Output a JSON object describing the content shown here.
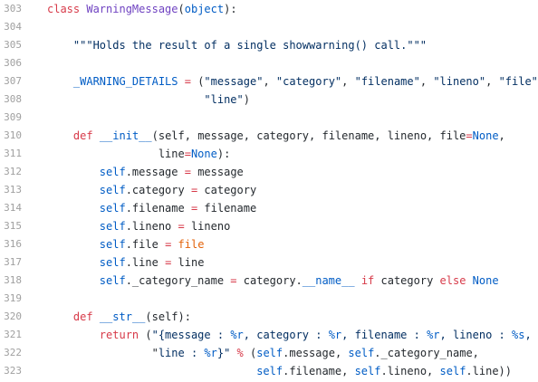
{
  "lines": [
    {
      "num": "303",
      "tokens": [
        {
          "t": "class",
          "c": "kw"
        },
        {
          "t": " "
        },
        {
          "t": "WarningMessage",
          "c": "cls"
        },
        {
          "t": "("
        },
        {
          "t": "object",
          "c": "bi"
        },
        {
          "t": "):"
        }
      ]
    },
    {
      "num": "304",
      "tokens": []
    },
    {
      "num": "305",
      "tokens": [
        {
          "t": "    "
        },
        {
          "t": "\"\"\"Holds the result of a single showwarning() call.\"\"\"",
          "c": "str"
        }
      ]
    },
    {
      "num": "306",
      "tokens": []
    },
    {
      "num": "307",
      "tokens": [
        {
          "t": "    "
        },
        {
          "t": "_WARNING_DETAILS",
          "c": "fn"
        },
        {
          "t": " "
        },
        {
          "t": "=",
          "c": "op"
        },
        {
          "t": " ("
        },
        {
          "t": "\"message\"",
          "c": "str"
        },
        {
          "t": ", "
        },
        {
          "t": "\"category\"",
          "c": "str"
        },
        {
          "t": ", "
        },
        {
          "t": "\"filename\"",
          "c": "str"
        },
        {
          "t": ", "
        },
        {
          "t": "\"lineno\"",
          "c": "str"
        },
        {
          "t": ", "
        },
        {
          "t": "\"file\"",
          "c": "str"
        },
        {
          "t": ","
        }
      ]
    },
    {
      "num": "308",
      "tokens": [
        {
          "t": "                        "
        },
        {
          "t": "\"line\"",
          "c": "str"
        },
        {
          "t": ")"
        }
      ]
    },
    {
      "num": "309",
      "tokens": []
    },
    {
      "num": "310",
      "tokens": [
        {
          "t": "    "
        },
        {
          "t": "def",
          "c": "kw"
        },
        {
          "t": " "
        },
        {
          "t": "__init__",
          "c": "fn"
        },
        {
          "t": "(self, message, category, filename, lineno, file"
        },
        {
          "t": "=",
          "c": "op"
        },
        {
          "t": "None",
          "c": "bi"
        },
        {
          "t": ","
        }
      ]
    },
    {
      "num": "311",
      "tokens": [
        {
          "t": "                 line"
        },
        {
          "t": "=",
          "c": "op"
        },
        {
          "t": "None",
          "c": "bi"
        },
        {
          "t": "):"
        }
      ]
    },
    {
      "num": "312",
      "tokens": [
        {
          "t": "        "
        },
        {
          "t": "self",
          "c": "bi"
        },
        {
          "t": ".message "
        },
        {
          "t": "=",
          "c": "op"
        },
        {
          "t": " message"
        }
      ]
    },
    {
      "num": "313",
      "tokens": [
        {
          "t": "        "
        },
        {
          "t": "self",
          "c": "bi"
        },
        {
          "t": ".category "
        },
        {
          "t": "=",
          "c": "op"
        },
        {
          "t": " category"
        }
      ]
    },
    {
      "num": "314",
      "tokens": [
        {
          "t": "        "
        },
        {
          "t": "self",
          "c": "bi"
        },
        {
          "t": ".filename "
        },
        {
          "t": "=",
          "c": "op"
        },
        {
          "t": " filename"
        }
      ]
    },
    {
      "num": "315",
      "tokens": [
        {
          "t": "        "
        },
        {
          "t": "self",
          "c": "bi"
        },
        {
          "t": ".lineno "
        },
        {
          "t": "=",
          "c": "op"
        },
        {
          "t": " lineno"
        }
      ]
    },
    {
      "num": "316",
      "tokens": [
        {
          "t": "        "
        },
        {
          "t": "self",
          "c": "bi"
        },
        {
          "t": ".file "
        },
        {
          "t": "=",
          "c": "op"
        },
        {
          "t": " "
        },
        {
          "t": "file",
          "c": "hl"
        }
      ]
    },
    {
      "num": "317",
      "tokens": [
        {
          "t": "        "
        },
        {
          "t": "self",
          "c": "bi"
        },
        {
          "t": ".line "
        },
        {
          "t": "=",
          "c": "op"
        },
        {
          "t": " line"
        }
      ]
    },
    {
      "num": "318",
      "tokens": [
        {
          "t": "        "
        },
        {
          "t": "self",
          "c": "bi"
        },
        {
          "t": "._category_name "
        },
        {
          "t": "=",
          "c": "op"
        },
        {
          "t": " category."
        },
        {
          "t": "__name__",
          "c": "bi"
        },
        {
          "t": " "
        },
        {
          "t": "if",
          "c": "kw"
        },
        {
          "t": " category "
        },
        {
          "t": "else",
          "c": "kw"
        },
        {
          "t": " "
        },
        {
          "t": "None",
          "c": "bi"
        }
      ]
    },
    {
      "num": "319",
      "tokens": []
    },
    {
      "num": "320",
      "tokens": [
        {
          "t": "    "
        },
        {
          "t": "def",
          "c": "kw"
        },
        {
          "t": " "
        },
        {
          "t": "__str__",
          "c": "fn"
        },
        {
          "t": "(self):"
        }
      ]
    },
    {
      "num": "321",
      "tokens": [
        {
          "t": "        "
        },
        {
          "t": "return",
          "c": "kw"
        },
        {
          "t": " ("
        },
        {
          "t": "\"{message : ",
          "c": "str"
        },
        {
          "t": "%r",
          "c": "bi"
        },
        {
          "t": ", category : ",
          "c": "str"
        },
        {
          "t": "%r",
          "c": "bi"
        },
        {
          "t": ", filename : ",
          "c": "str"
        },
        {
          "t": "%r",
          "c": "bi"
        },
        {
          "t": ", lineno : ",
          "c": "str"
        },
        {
          "t": "%s",
          "c": "bi"
        },
        {
          "t": ", \"",
          "c": "str"
        }
      ]
    },
    {
      "num": "322",
      "tokens": [
        {
          "t": "                \""
        },
        {
          "t": "line : ",
          "c": "str"
        },
        {
          "t": "%r",
          "c": "bi"
        },
        {
          "t": "}\"",
          "c": "str"
        },
        {
          "t": " "
        },
        {
          "t": "%",
          "c": "op"
        },
        {
          "t": " ("
        },
        {
          "t": "self",
          "c": "bi"
        },
        {
          "t": ".message, "
        },
        {
          "t": "self",
          "c": "bi"
        },
        {
          "t": "._category_name,"
        }
      ]
    },
    {
      "num": "323",
      "tokens": [
        {
          "t": "                                "
        },
        {
          "t": "self",
          "c": "bi"
        },
        {
          "t": ".filename, "
        },
        {
          "t": "self",
          "c": "bi"
        },
        {
          "t": ".lineno, "
        },
        {
          "t": "self",
          "c": "bi"
        },
        {
          "t": ".line))"
        }
      ]
    }
  ]
}
